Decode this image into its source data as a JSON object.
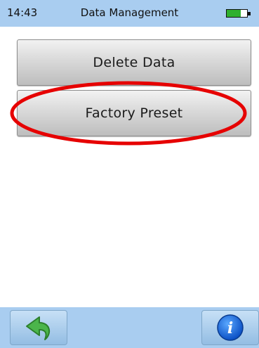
{
  "status": {
    "time": "14:43",
    "title": "Data Management",
    "battery_level": 0.7,
    "battery_icon": "battery-icon",
    "battery_color": "#2fb02f"
  },
  "buttons": {
    "delete_label": "Delete Data",
    "factory_label": "Factory Preset"
  },
  "annotation": {
    "type": "ellipse",
    "target": "factory-preset-button",
    "color": "#e60000"
  },
  "footer": {
    "back_icon": "back-arrow-icon",
    "info_icon": "info-icon",
    "accent": "#a9cdf0"
  }
}
